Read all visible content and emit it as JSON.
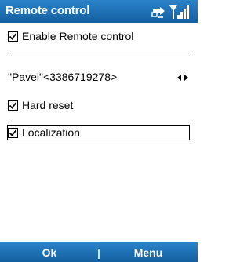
{
  "title_bar": {
    "title": "Remote control",
    "status_icons": [
      "data-connection-icon",
      "signal-strength-icon"
    ]
  },
  "settings": {
    "enable_remote_control": {
      "label": "Enable Remote control",
      "checked": true
    },
    "contact_picker": {
      "value": "\"Pavel\"<3386719278>"
    },
    "hard_reset": {
      "label": "Hard reset",
      "checked": true
    },
    "localization": {
      "label": "Localization",
      "checked": true,
      "focused": true
    }
  },
  "softkeys": {
    "left": "Ok",
    "right": "Menu"
  },
  "colors": {
    "bar_blue": "#1d6fb3",
    "text": "#000000",
    "background": "#ffffff"
  }
}
